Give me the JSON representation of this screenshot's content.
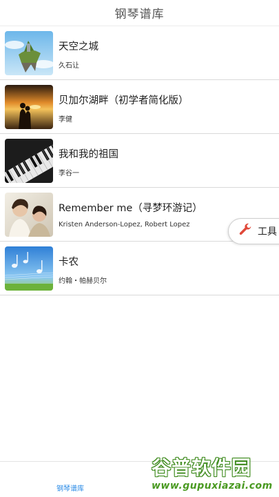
{
  "header": {
    "title": "钢琴谱库"
  },
  "songs": [
    {
      "title": "天空之城",
      "artist": "久石让",
      "thumb": "castle-in-the-sky-image"
    },
    {
      "title": "贝加尔湖畔（初学者简化版）",
      "artist": "李健",
      "thumb": "lake-sunset-couple-image"
    },
    {
      "title": "我和我的祖国",
      "artist": "李谷一",
      "thumb": "piano-keys-image"
    },
    {
      "title": "Remember me（寻梦环游记）",
      "artist": "Kristen Anderson-Lopez, Robert Lopez",
      "thumb": "couple-portrait-image"
    },
    {
      "title": "卡农",
      "artist": "约翰・帕赫贝尔",
      "thumb": "canon-music-notes-image"
    }
  ],
  "tool_button": {
    "label": "工具",
    "icon": "wrench-icon"
  },
  "bottom_nav": {
    "tab_label": "钢琴谱库"
  },
  "watermark": {
    "logo": "谷普软件园",
    "url": "www.gupuxiazai.com"
  },
  "colors": {
    "accent": "#2b8be6",
    "tool_icon": "#e0493a",
    "watermark_green": "#4a9a22"
  }
}
